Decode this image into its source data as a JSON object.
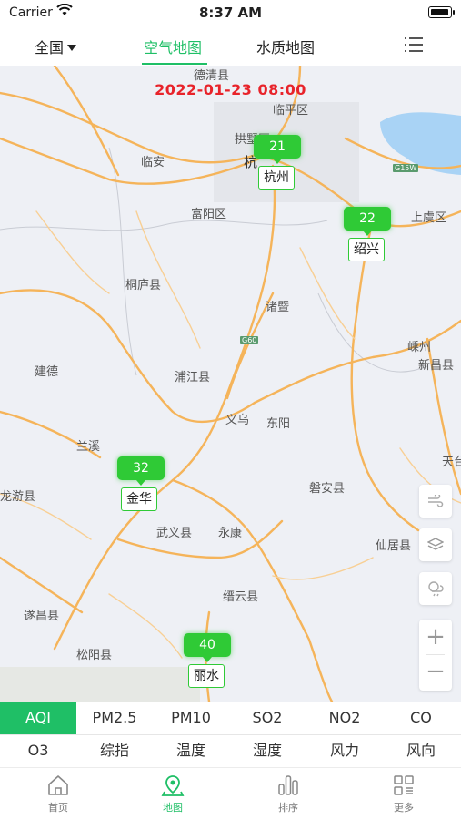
{
  "status_bar": {
    "carrier": "Carrier",
    "time": "8:37 AM"
  },
  "header": {
    "region": "全国",
    "tabs": [
      {
        "label": "空气地图",
        "active": true
      },
      {
        "label": "水质地图",
        "active": false
      }
    ],
    "menu_icon": "list-menu-icon"
  },
  "map": {
    "datetime": "2022-01-23 08:00",
    "places": {
      "deqing": "德清县",
      "linping": "临平区",
      "gongshu": "拱墅区",
      "linan": "临安",
      "fuyang": "富阳区",
      "shaoxing_label": "绍兴",
      "shangyu": "上虞区",
      "tonglu": "桐庐县",
      "zhuji": "诸暨",
      "jiande": "建德",
      "pujiang": "浦江县",
      "yiwu": "义乌",
      "dongyang": "东阳",
      "lanxi": "兰溪",
      "shengzhou": "嵊州",
      "xinchang": "新昌县",
      "tiantai": "天台",
      "longyou": "龙游县",
      "panan": "磐安县",
      "wuyi": "武义县",
      "yongkang": "永康",
      "xianju": "仙居县",
      "jinyun": "缙云县",
      "suichang": "遂昌县",
      "songyang": "松阳县",
      "hang": "杭"
    },
    "roads": {
      "g60": "G60",
      "g15w": "G15W"
    },
    "markers": [
      {
        "city": "杭州",
        "aqi": "21"
      },
      {
        "city": "绍兴",
        "aqi": "22"
      },
      {
        "city": "金华",
        "aqi": "32"
      },
      {
        "city": "丽水",
        "aqi": "40"
      }
    ],
    "marker_color": "#2fca36",
    "controls": [
      "wind-icon",
      "layers-icon",
      "weather-icon",
      "zoom-in-icon",
      "zoom-out-icon"
    ]
  },
  "pollutants": {
    "row1": [
      "AQI",
      "PM2.5",
      "PM10",
      "SO2",
      "NO2",
      "CO"
    ],
    "row2": [
      "O3",
      "综指",
      "温度",
      "湿度",
      "风力",
      "风向"
    ],
    "active": "AQI"
  },
  "tabbar": [
    {
      "label": "首页",
      "icon": "home-icon",
      "active": false
    },
    {
      "label": "地图",
      "icon": "map-pin-icon",
      "active": true
    },
    {
      "label": "排序",
      "icon": "ranking-bars-icon",
      "active": false
    },
    {
      "label": "更多",
      "icon": "grid-more-icon",
      "active": false
    }
  ],
  "colors": {
    "accent": "#1fbf66",
    "datetime": "#e8232a",
    "water": "#a9d3f5",
    "road": "#f5b45a"
  }
}
